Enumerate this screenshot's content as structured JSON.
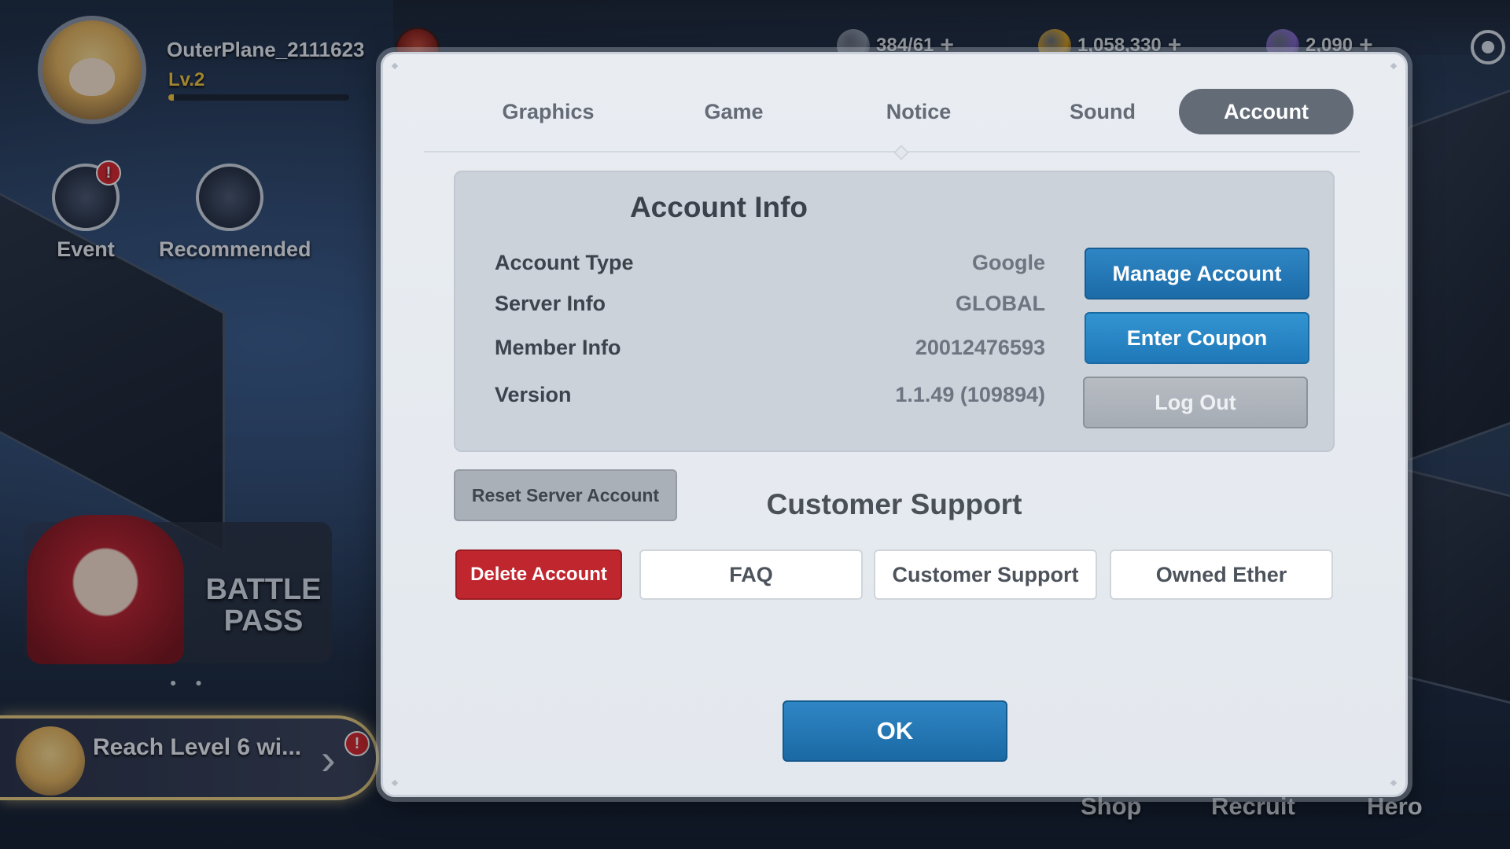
{
  "player": {
    "name": "OuterPlane_2111623",
    "level": "Lv.2",
    "xp_fraction": 0.03
  },
  "currencies": [
    {
      "value": "384/61",
      "icon": "stamina-icon",
      "color": "#8c95a5"
    },
    {
      "value": "1,058,330",
      "icon": "gold-coin-icon",
      "color": "#e0a521"
    },
    {
      "value": "2,090",
      "icon": "ether-crystal-icon",
      "color": "#8a6ad6"
    }
  ],
  "side_menu": {
    "event_label": "Event",
    "recommended_label": "Recommended",
    "alert": "!"
  },
  "battle_pass": {
    "line1": "BATTLE",
    "line2": "PASS"
  },
  "quest": {
    "text": "Reach Level 6 wi...",
    "alert": "!"
  },
  "bottom_nav": {
    "shop": "Shop",
    "recruit": "Recruit",
    "hero": "Hero"
  },
  "modal": {
    "tabs": [
      {
        "label": "Graphics",
        "active": false
      },
      {
        "label": "Game",
        "active": false
      },
      {
        "label": "Notice",
        "active": false
      },
      {
        "label": "Sound",
        "active": false
      },
      {
        "label": "Account",
        "active": true
      }
    ],
    "account_info": {
      "title": "Account Info",
      "rows": [
        {
          "label": "Account Type",
          "value": "Google"
        },
        {
          "label": "Server Info",
          "value": "GLOBAL"
        },
        {
          "label": "Member Info",
          "value": "20012476593"
        },
        {
          "label": "Version",
          "value": "1.1.49 (109894)"
        }
      ],
      "manage_account": "Manage Account",
      "enter_coupon": "Enter Coupon",
      "log_out": "Log Out"
    },
    "reset_server_account": "Reset Server Account",
    "customer_support": {
      "title": "Customer Support",
      "delete_account": "Delete Account",
      "faq": "FAQ",
      "customer_support": "Customer Support",
      "owned_ether": "Owned Ether"
    },
    "ok": "OK"
  }
}
